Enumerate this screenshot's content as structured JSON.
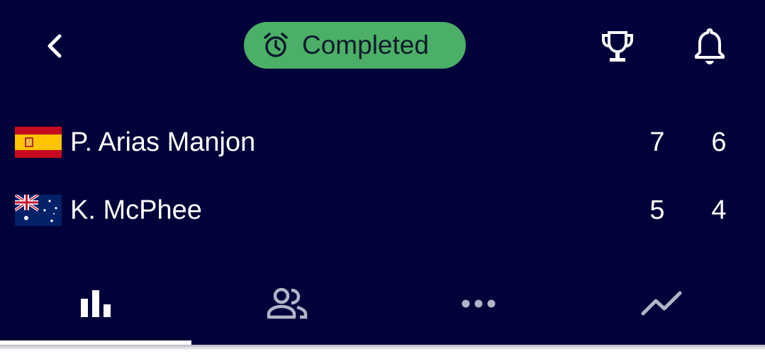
{
  "header": {
    "status_label": "Completed",
    "status_color": "#4caf67",
    "icons": [
      "chevron-left-icon",
      "alarm-clock-icon",
      "trophy-icon",
      "bell-icon"
    ]
  },
  "players": [
    {
      "name": "P. Arias Manjon",
      "flag": "spain-flag-icon",
      "set1": "7",
      "set2": "6"
    },
    {
      "name": "K. McPhee",
      "flag": "australia-flag-icon",
      "set1": "5",
      "set2": "4"
    }
  ],
  "tabs": [
    {
      "icon": "bar-chart-icon",
      "active": true
    },
    {
      "icon": "people-icon",
      "active": false
    },
    {
      "icon": "more-horizontal-icon",
      "active": false
    },
    {
      "icon": "trend-line-icon",
      "active": false
    }
  ],
  "colors": {
    "background": "#02023a",
    "accent": "#4caf67",
    "inactive_icon": "#b3b3c8"
  }
}
